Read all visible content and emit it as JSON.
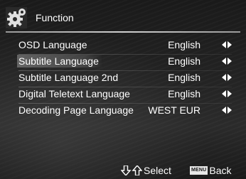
{
  "header": {
    "title": "Function",
    "icon": "gear-icon"
  },
  "menu": {
    "selected_index": 1,
    "items": [
      {
        "label": "OSD Language",
        "value": "English"
      },
      {
        "label": "Subtitle Language",
        "value": "English"
      },
      {
        "label": "Subtitle Language 2nd",
        "value": "English"
      },
      {
        "label": "Digital Teletext Language",
        "value": "English"
      },
      {
        "label": "Decoding Page Language",
        "value": "WEST EUR"
      }
    ],
    "arrow_icon": "left-right-arrows-icon"
  },
  "footer": {
    "select_label": "Select",
    "select_icon": "up-down-arrows-icon",
    "menu_key_label": "MENU",
    "back_label": "Back"
  }
}
